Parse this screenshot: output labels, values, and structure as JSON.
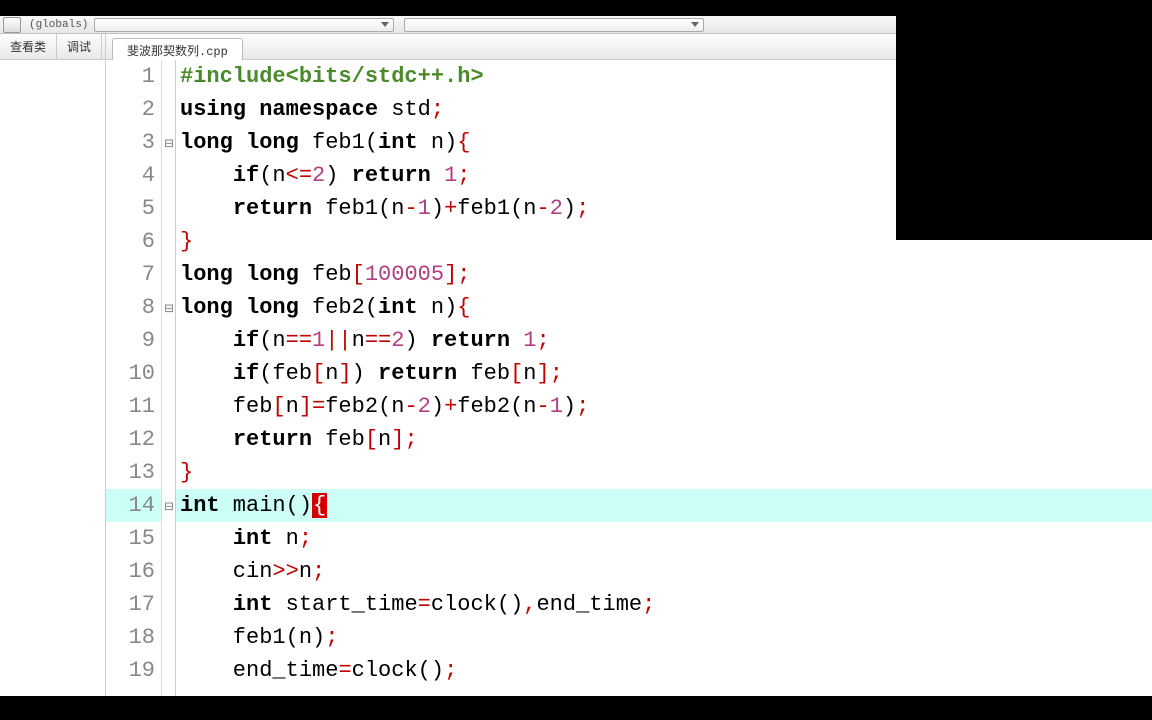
{
  "toolbar": {
    "scope_label": "(globals)"
  },
  "sidebar": {
    "tabs": [
      "查看类",
      "调试"
    ]
  },
  "file_tab": "斐波那契数列.cpp",
  "fold_marks": {
    "3": "⊟",
    "8": "⊟",
    "14": "⊟"
  },
  "code": [
    {
      "n": 1,
      "hl": false,
      "tokens": [
        [
          "#include<bits/stdc++.h>",
          "preproc"
        ]
      ]
    },
    {
      "n": 2,
      "hl": false,
      "tokens": [
        [
          "using",
          "kw"
        ],
        [
          " ",
          "ident"
        ],
        [
          "namespace",
          "kw"
        ],
        [
          " std",
          "ident"
        ],
        [
          ";",
          "red"
        ]
      ]
    },
    {
      "n": 3,
      "hl": false,
      "tokens": [
        [
          "long",
          "kw"
        ],
        [
          " ",
          "ident"
        ],
        [
          "long",
          "kw"
        ],
        [
          " feb1",
          "ident"
        ],
        [
          "(",
          "paren"
        ],
        [
          "int",
          "kw"
        ],
        [
          " n",
          "ident"
        ],
        [
          ")",
          "paren"
        ],
        [
          "{",
          "red"
        ]
      ]
    },
    {
      "n": 4,
      "hl": false,
      "tokens": [
        [
          "    ",
          "ident"
        ],
        [
          "if",
          "kw"
        ],
        [
          "(",
          "paren"
        ],
        [
          "n",
          "ident"
        ],
        [
          "<=",
          "op"
        ],
        [
          "2",
          "num"
        ],
        [
          ")",
          "paren"
        ],
        [
          " ",
          "ident"
        ],
        [
          "return",
          "kw"
        ],
        [
          " ",
          "ident"
        ],
        [
          "1",
          "num"
        ],
        [
          ";",
          "red"
        ]
      ]
    },
    {
      "n": 5,
      "hl": false,
      "tokens": [
        [
          "    ",
          "ident"
        ],
        [
          "return",
          "kw"
        ],
        [
          " feb1",
          "ident"
        ],
        [
          "(",
          "paren"
        ],
        [
          "n",
          "ident"
        ],
        [
          "-",
          "op"
        ],
        [
          "1",
          "num"
        ],
        [
          ")",
          "paren"
        ],
        [
          "+",
          "op"
        ],
        [
          "feb1",
          "ident"
        ],
        [
          "(",
          "paren"
        ],
        [
          "n",
          "ident"
        ],
        [
          "-",
          "op"
        ],
        [
          "2",
          "num"
        ],
        [
          ")",
          "paren"
        ],
        [
          ";",
          "red"
        ]
      ]
    },
    {
      "n": 6,
      "hl": false,
      "tokens": [
        [
          "}",
          "red"
        ]
      ]
    },
    {
      "n": 7,
      "hl": false,
      "tokens": [
        [
          "long",
          "kw"
        ],
        [
          " ",
          "ident"
        ],
        [
          "long",
          "kw"
        ],
        [
          " feb",
          "ident"
        ],
        [
          "[",
          "brack"
        ],
        [
          "100005",
          "num"
        ],
        [
          "]",
          "brack"
        ],
        [
          ";",
          "red"
        ]
      ]
    },
    {
      "n": 8,
      "hl": false,
      "tokens": [
        [
          "long",
          "kw"
        ],
        [
          " ",
          "ident"
        ],
        [
          "long",
          "kw"
        ],
        [
          " feb2",
          "ident"
        ],
        [
          "(",
          "paren"
        ],
        [
          "int",
          "kw"
        ],
        [
          " n",
          "ident"
        ],
        [
          ")",
          "paren"
        ],
        [
          "{",
          "red"
        ]
      ]
    },
    {
      "n": 9,
      "hl": false,
      "tokens": [
        [
          "    ",
          "ident"
        ],
        [
          "if",
          "kw"
        ],
        [
          "(",
          "paren"
        ],
        [
          "n",
          "ident"
        ],
        [
          "==",
          "op"
        ],
        [
          "1",
          "num"
        ],
        [
          "||",
          "op"
        ],
        [
          "n",
          "ident"
        ],
        [
          "==",
          "op"
        ],
        [
          "2",
          "num"
        ],
        [
          ")",
          "paren"
        ],
        [
          " ",
          "ident"
        ],
        [
          "return",
          "kw"
        ],
        [
          " ",
          "ident"
        ],
        [
          "1",
          "num"
        ],
        [
          ";",
          "red"
        ]
      ]
    },
    {
      "n": 10,
      "hl": false,
      "tokens": [
        [
          "    ",
          "ident"
        ],
        [
          "if",
          "kw"
        ],
        [
          "(",
          "paren"
        ],
        [
          "feb",
          "ident"
        ],
        [
          "[",
          "brack"
        ],
        [
          "n",
          "ident"
        ],
        [
          "]",
          "brack"
        ],
        [
          ")",
          "paren"
        ],
        [
          " ",
          "ident"
        ],
        [
          "return",
          "kw"
        ],
        [
          " feb",
          "ident"
        ],
        [
          "[",
          "brack"
        ],
        [
          "n",
          "ident"
        ],
        [
          "]",
          "brack"
        ],
        [
          ";",
          "red"
        ]
      ]
    },
    {
      "n": 11,
      "hl": false,
      "tokens": [
        [
          "    feb",
          "ident"
        ],
        [
          "[",
          "brack"
        ],
        [
          "n",
          "ident"
        ],
        [
          "]",
          "brack"
        ],
        [
          "=",
          "op"
        ],
        [
          "feb2",
          "ident"
        ],
        [
          "(",
          "paren"
        ],
        [
          "n",
          "ident"
        ],
        [
          "-",
          "op"
        ],
        [
          "2",
          "num"
        ],
        [
          ")",
          "paren"
        ],
        [
          "+",
          "op"
        ],
        [
          "feb2",
          "ident"
        ],
        [
          "(",
          "paren"
        ],
        [
          "n",
          "ident"
        ],
        [
          "-",
          "op"
        ],
        [
          "1",
          "num"
        ],
        [
          ")",
          "paren"
        ],
        [
          ";",
          "red"
        ]
      ]
    },
    {
      "n": 12,
      "hl": false,
      "tokens": [
        [
          "    ",
          "ident"
        ],
        [
          "return",
          "kw"
        ],
        [
          " feb",
          "ident"
        ],
        [
          "[",
          "brack"
        ],
        [
          "n",
          "ident"
        ],
        [
          "]",
          "brack"
        ],
        [
          ";",
          "red"
        ]
      ]
    },
    {
      "n": 13,
      "hl": false,
      "tokens": [
        [
          "}",
          "red"
        ]
      ]
    },
    {
      "n": 14,
      "hl": true,
      "tokens": [
        [
          "int",
          "kw"
        ],
        [
          " main",
          "ident"
        ],
        [
          "(",
          "paren"
        ],
        [
          ")",
          "paren"
        ],
        [
          "{",
          "cursor"
        ]
      ]
    },
    {
      "n": 15,
      "hl": false,
      "tokens": [
        [
          "    ",
          "ident"
        ],
        [
          "int",
          "kw"
        ],
        [
          " n",
          "ident"
        ],
        [
          ";",
          "red"
        ]
      ]
    },
    {
      "n": 16,
      "hl": false,
      "tokens": [
        [
          "    cin",
          "ident"
        ],
        [
          ">>",
          "op"
        ],
        [
          "n",
          "ident"
        ],
        [
          ";",
          "red"
        ]
      ]
    },
    {
      "n": 17,
      "hl": false,
      "tokens": [
        [
          "    ",
          "ident"
        ],
        [
          "int",
          "kw"
        ],
        [
          " start_time",
          "ident"
        ],
        [
          "=",
          "op"
        ],
        [
          "clock",
          "ident"
        ],
        [
          "(",
          "paren"
        ],
        [
          ")",
          "paren"
        ],
        [
          ",",
          "red"
        ],
        [
          "end_time",
          "ident"
        ],
        [
          ";",
          "red"
        ]
      ]
    },
    {
      "n": 18,
      "hl": false,
      "tokens": [
        [
          "    feb1",
          "ident"
        ],
        [
          "(",
          "paren"
        ],
        [
          "n",
          "ident"
        ],
        [
          ")",
          "paren"
        ],
        [
          ";",
          "red"
        ]
      ]
    },
    {
      "n": 19,
      "hl": false,
      "tokens": [
        [
          "    end_time",
          "ident"
        ],
        [
          "=",
          "op"
        ],
        [
          "clock",
          "ident"
        ],
        [
          "(",
          "paren"
        ],
        [
          ")",
          "paren"
        ],
        [
          ";",
          "red"
        ]
      ]
    }
  ]
}
